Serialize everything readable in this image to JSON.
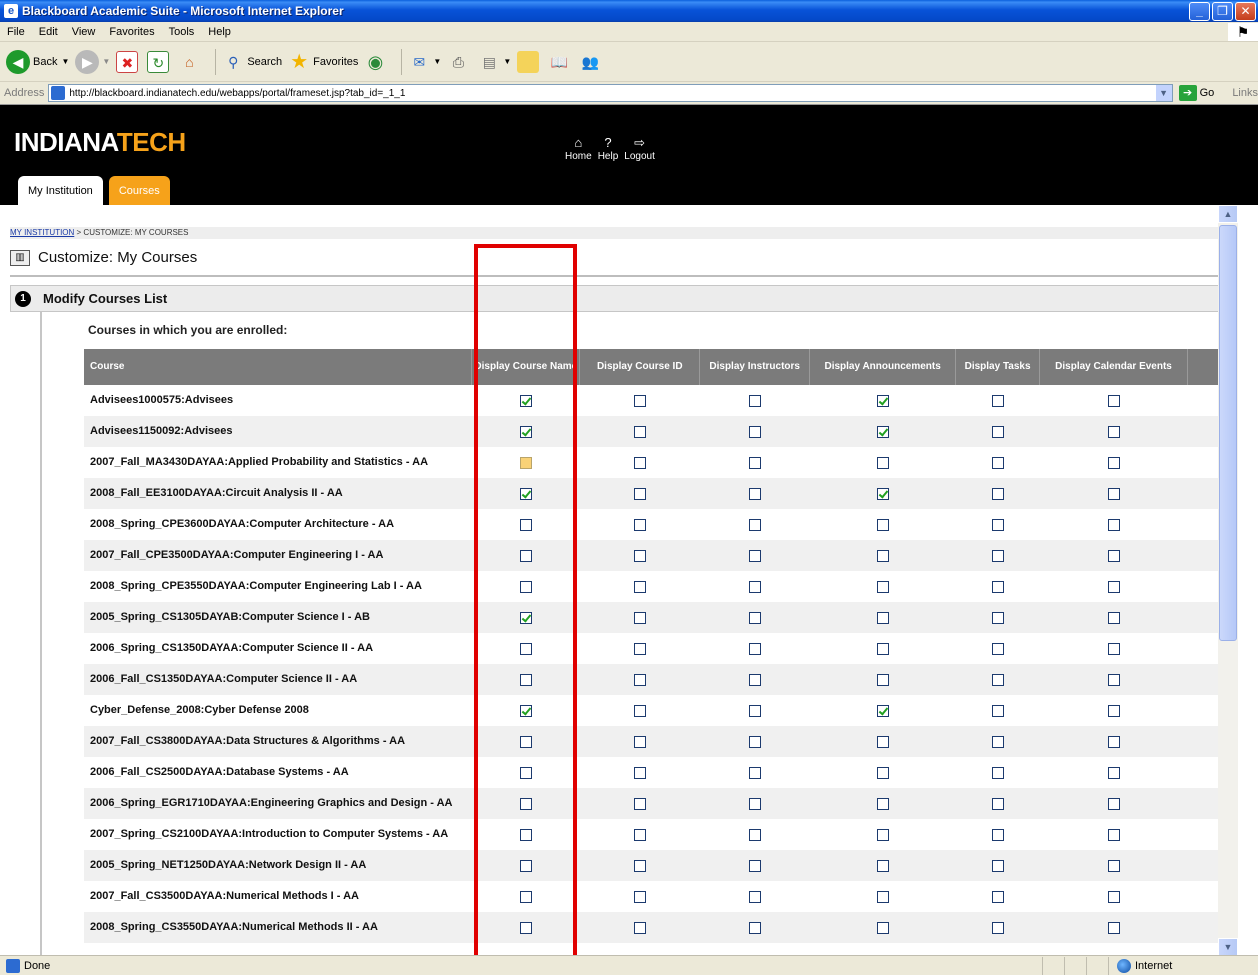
{
  "window": {
    "title": "Blackboard Academic Suite - Microsoft Internet Explorer",
    "icon": "ie-page-icon"
  },
  "menu": [
    "File",
    "Edit",
    "View",
    "Favorites",
    "Tools",
    "Help"
  ],
  "toolbar": {
    "back_label": "Back",
    "search_label": "Search",
    "favorites_label": "Favorites"
  },
  "address": {
    "label": "Address",
    "url": "http://blackboard.indianatech.edu/webapps/portal/frameset.jsp?tab_id=_1_1",
    "go_label": "Go",
    "links_label": "Links"
  },
  "header": {
    "logo_a": "INDIANA",
    "logo_b": "TECH",
    "links": [
      "Home",
      "Help",
      "Logout"
    ],
    "tabs": [
      "My Institution",
      "Courses"
    ]
  },
  "breadcrumb": {
    "root": "MY INSTITUTION",
    "sep": " > ",
    "current": "CUSTOMIZE: MY COURSES"
  },
  "page": {
    "title": "Customize: My Courses",
    "step_number": "1",
    "step_title": "Modify Courses List",
    "enrolled_label": "Courses in which you are enrolled:"
  },
  "table": {
    "headers": [
      "Course",
      "Display Course Name",
      "Display Course ID",
      "Display Instructors",
      "Display Announcements",
      "Display Tasks",
      "Display Calendar Events"
    ],
    "rows": [
      {
        "course": "Advisees1000575:Advisees",
        "checks": [
          "checked",
          "unchecked",
          "unchecked",
          "checked",
          "unchecked",
          "unchecked"
        ]
      },
      {
        "course": "Advisees1150092:Advisees",
        "checks": [
          "checked",
          "unchecked",
          "unchecked",
          "checked",
          "unchecked",
          "unchecked"
        ]
      },
      {
        "course": "2007_Fall_MA3430DAYAA:Applied Probability and Statistics - AA",
        "checks": [
          "partial",
          "unchecked",
          "unchecked",
          "unchecked",
          "unchecked",
          "unchecked"
        ]
      },
      {
        "course": "2008_Fall_EE3100DAYAA:Circuit Analysis II - AA",
        "checks": [
          "checked",
          "unchecked",
          "unchecked",
          "checked",
          "unchecked",
          "unchecked"
        ]
      },
      {
        "course": "2008_Spring_CPE3600DAYAA:Computer Architecture - AA",
        "checks": [
          "unchecked",
          "unchecked",
          "unchecked",
          "unchecked",
          "unchecked",
          "unchecked"
        ]
      },
      {
        "course": "2007_Fall_CPE3500DAYAA:Computer Engineering I - AA",
        "checks": [
          "unchecked",
          "unchecked",
          "unchecked",
          "unchecked",
          "unchecked",
          "unchecked"
        ]
      },
      {
        "course": "2008_Spring_CPE3550DAYAA:Computer Engineering Lab I - AA",
        "checks": [
          "unchecked",
          "unchecked",
          "unchecked",
          "unchecked",
          "unchecked",
          "unchecked"
        ]
      },
      {
        "course": "2005_Spring_CS1305DAYAB:Computer Science I - AB",
        "checks": [
          "checked",
          "unchecked",
          "unchecked",
          "unchecked",
          "unchecked",
          "unchecked"
        ]
      },
      {
        "course": "2006_Spring_CS1350DAYAA:Computer Science II - AA",
        "checks": [
          "unchecked",
          "unchecked",
          "unchecked",
          "unchecked",
          "unchecked",
          "unchecked"
        ]
      },
      {
        "course": "2006_Fall_CS1350DAYAA:Computer Science II - AA",
        "checks": [
          "unchecked",
          "unchecked",
          "unchecked",
          "unchecked",
          "unchecked",
          "unchecked"
        ]
      },
      {
        "course": "Cyber_Defense_2008:Cyber Defense 2008",
        "checks": [
          "checked",
          "unchecked",
          "unchecked",
          "checked",
          "unchecked",
          "unchecked"
        ]
      },
      {
        "course": "2007_Fall_CS3800DAYAA:Data Structures & Algorithms - AA",
        "checks": [
          "unchecked",
          "unchecked",
          "unchecked",
          "unchecked",
          "unchecked",
          "unchecked"
        ]
      },
      {
        "course": "2006_Fall_CS2500DAYAA:Database Systems - AA",
        "checks": [
          "unchecked",
          "unchecked",
          "unchecked",
          "unchecked",
          "unchecked",
          "unchecked"
        ]
      },
      {
        "course": "2006_Spring_EGR1710DAYAA:Engineering Graphics and Design - AA",
        "checks": [
          "unchecked",
          "unchecked",
          "unchecked",
          "unchecked",
          "unchecked",
          "unchecked"
        ]
      },
      {
        "course": "2007_Spring_CS2100DAYAA:Introduction to Computer Systems - AA",
        "checks": [
          "unchecked",
          "unchecked",
          "unchecked",
          "unchecked",
          "unchecked",
          "unchecked"
        ]
      },
      {
        "course": "2005_Spring_NET1250DAYAA:Network Design II - AA",
        "checks": [
          "unchecked",
          "unchecked",
          "unchecked",
          "unchecked",
          "unchecked",
          "unchecked"
        ]
      },
      {
        "course": "2007_Fall_CS3500DAYAA:Numerical Methods I - AA",
        "checks": [
          "unchecked",
          "unchecked",
          "unchecked",
          "unchecked",
          "unchecked",
          "unchecked"
        ]
      },
      {
        "course": "2008_Spring_CS3550DAYAA:Numerical Methods II - AA",
        "checks": [
          "unchecked",
          "unchecked",
          "unchecked",
          "unchecked",
          "unchecked",
          "unchecked"
        ]
      }
    ]
  },
  "status": {
    "text": "Done",
    "zone": "Internet"
  },
  "colors": {
    "accent": "#f6a21a",
    "header_bg": "#000000",
    "highlight": "#e00000"
  }
}
